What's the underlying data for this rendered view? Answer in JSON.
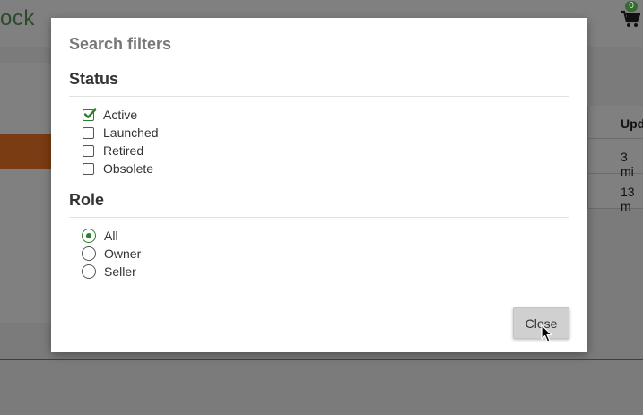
{
  "background": {
    "brand_fragment": "ock",
    "cart_count": "0",
    "table": {
      "header": "Upd",
      "rows": [
        "3 mi",
        "13 m"
      ]
    }
  },
  "modal": {
    "title": "Search filters",
    "status": {
      "heading": "Status",
      "options": [
        {
          "label": "Active",
          "checked": true
        },
        {
          "label": "Launched",
          "checked": false
        },
        {
          "label": "Retired",
          "checked": false
        },
        {
          "label": "Obsolete",
          "checked": false
        }
      ]
    },
    "role": {
      "heading": "Role",
      "selected": "All",
      "options": [
        {
          "label": "All"
        },
        {
          "label": "Owner"
        },
        {
          "label": "Seller"
        }
      ]
    },
    "close_label": "Close"
  },
  "colors": {
    "accent_green": "#2e7d32",
    "overlay": "#808080",
    "orange_row": "#7a3c12"
  },
  "icons": {
    "cart": "shopping-cart-icon",
    "checkbox_checked": "checkmark-icon",
    "cursor": "mouse-pointer-icon"
  }
}
